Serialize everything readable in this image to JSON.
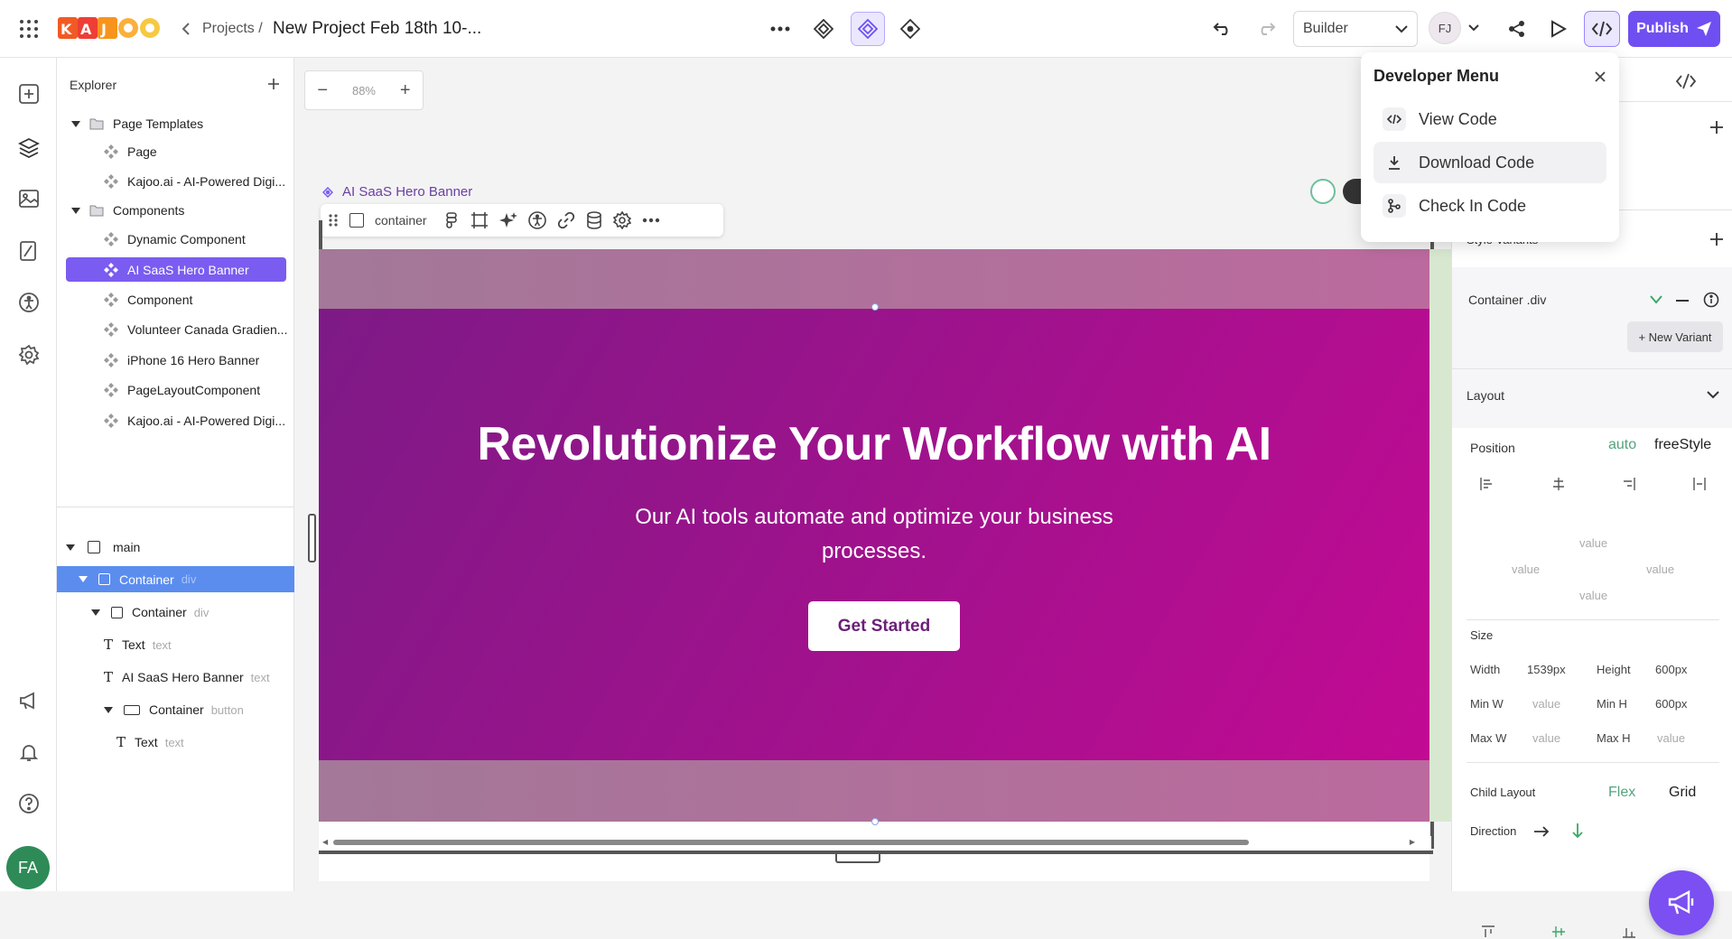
{
  "topbar": {
    "logo_text": "KAJOO",
    "breadcrumb_projects": "Projects /",
    "project_title": "New Project Feb 18th 10-...",
    "mode_select": "Builder",
    "avatar_initials": "FJ",
    "publish_label": "Publish"
  },
  "explorer": {
    "title": "Explorer",
    "items": [
      {
        "label": "Page Templates",
        "kind": "folder"
      },
      {
        "label": "Page",
        "kind": "component"
      },
      {
        "label": "Kajoo.ai - AI-Powered Digi...",
        "kind": "component"
      },
      {
        "label": "Components",
        "kind": "folder"
      },
      {
        "label": "Dynamic Component",
        "kind": "component"
      },
      {
        "label": "AI SaaS Hero Banner",
        "kind": "component",
        "selected": true
      },
      {
        "label": "Component",
        "kind": "component"
      },
      {
        "label": "Volunteer Canada Gradien...",
        "kind": "component"
      },
      {
        "label": "iPhone 16 Hero Banner",
        "kind": "component"
      },
      {
        "label": "PageLayoutComponent",
        "kind": "component"
      },
      {
        "label": "Kajoo.ai - AI-Powered Digi...",
        "kind": "component"
      }
    ]
  },
  "layers": [
    {
      "label": "main",
      "type": ""
    },
    {
      "label": "Container",
      "type": "div"
    },
    {
      "label": "Container",
      "type": "div"
    },
    {
      "label": "Text",
      "type": "text"
    },
    {
      "label": "AI SaaS Hero Banner",
      "type": "text"
    },
    {
      "label": "Container",
      "type": "button"
    },
    {
      "label": "Text",
      "type": "text"
    }
  ],
  "canvas": {
    "zoom": "88%",
    "component_label": "AI SaaS Hero Banner",
    "toolbar_element": "container",
    "hero_title": "Revolutionize Your Workflow with AI",
    "hero_subtitle_line1": "Our AI tools automate and optimize your business",
    "hero_subtitle_line2": "processes.",
    "cta_label": "Get Started"
  },
  "dev_menu": {
    "title": "Developer Menu",
    "items": [
      "View Code",
      "Download Code",
      "Check In Code"
    ]
  },
  "right_panel": {
    "style_variants": "Style Variants",
    "variant_name": "Container .div",
    "new_variant": "+ New Variant",
    "layout_title": "Layout",
    "position_label": "Position",
    "position_auto": "auto",
    "position_freestyle": "freeStyle",
    "placeholder_value": "value",
    "size_label": "Size",
    "width_label": "Width",
    "width_value": "1539px",
    "height_label": "Height",
    "height_value": "600px",
    "min_w_label": "Min W",
    "min_h_label": "Min H",
    "min_h_value": "600px",
    "max_w_label": "Max W",
    "max_h_label": "Max H",
    "child_layout_label": "Child Layout",
    "flex_label": "Flex",
    "grid_label": "Grid",
    "direction_label": "Direction"
  },
  "user": {
    "initials": "FA"
  },
  "colors": {
    "accent": "#6f4ff2",
    "selected": "#7b5cf0",
    "hero_start": "#7d1a86",
    "hero_end": "#c20a93",
    "green": "#3aa866"
  }
}
